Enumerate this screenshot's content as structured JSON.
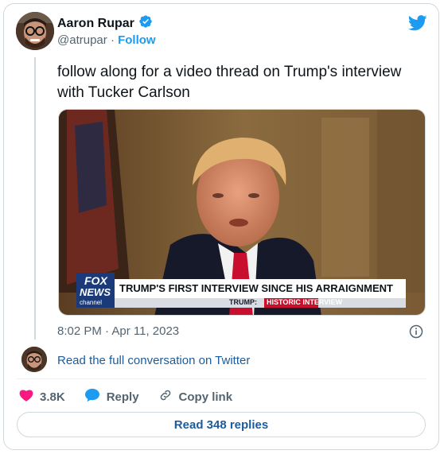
{
  "author": {
    "name": "Aaron Rupar",
    "handle": "@atrupar",
    "separator": "·",
    "follow_label": "Follow"
  },
  "tweet": {
    "text": "follow along for a video thread on Trump's interview with Tucker Carlson",
    "timestamp": "8:02 PM · Apr 11, 2023"
  },
  "media": {
    "network_logo_top": "FOX",
    "network_logo_mid": "NEWS",
    "network_logo_bottom": "channel",
    "chyron_headline": "TRUMP'S FIRST INTERVIEW SINCE HIS ARRAIGNMENT",
    "chyron_sub_label": "TRUMP:",
    "chyron_sub_text": "HISTORIC INTERVIEW"
  },
  "conversation": {
    "read_full_label": "Read the full conversation on Twitter"
  },
  "actions": {
    "likes_count": "3.8K",
    "reply_label": "Reply",
    "copy_link_label": "Copy link",
    "read_replies_label": "Read 348 replies"
  },
  "colors": {
    "twitter_blue": "#1d9bf0",
    "like_pink": "#f91880",
    "link_blue": "#1d5b9a",
    "chyron_red": "#c8102e"
  },
  "icons": [
    "verified-badge-icon",
    "twitter-bird-icon",
    "info-icon",
    "heart-icon",
    "reply-bubble-icon",
    "link-icon"
  ]
}
